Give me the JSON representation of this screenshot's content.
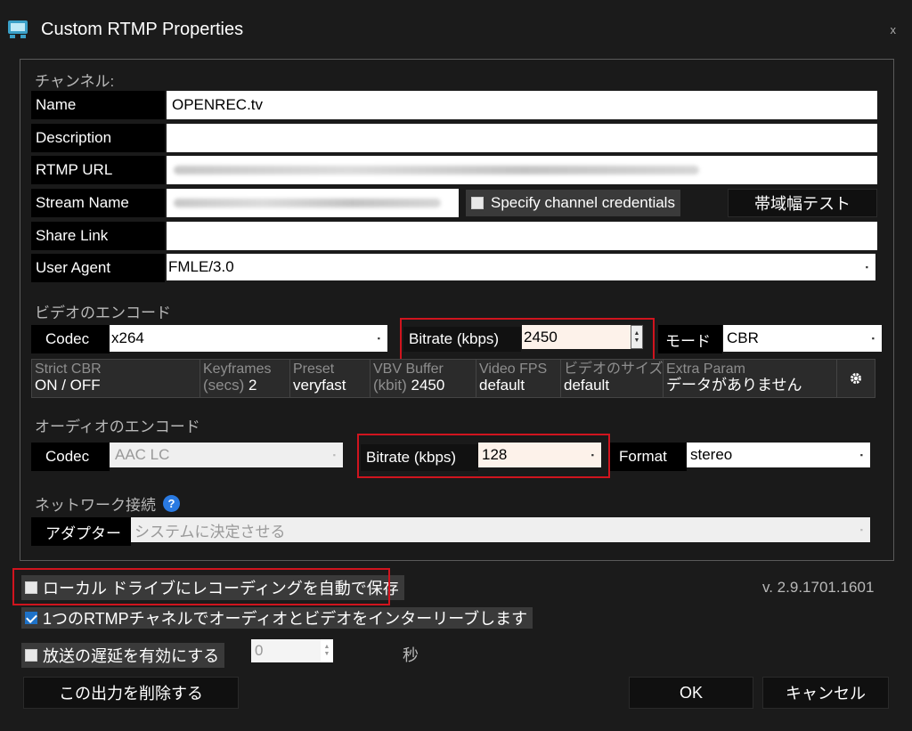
{
  "window": {
    "title": "Custom RTMP Properties",
    "close": "x",
    "version": "v. 2.9.1701.1601"
  },
  "channel": {
    "section": "チャンネル:",
    "name_label": "Name",
    "name_value": "OPENREC.tv",
    "description_label": "Description",
    "description_value": "",
    "rtmp_url_label": "RTMP URL",
    "stream_name_label": "Stream Name",
    "specify_credentials": "Specify channel credentials",
    "bandwidth_test": "帯域幅テスト",
    "share_link_label": "Share Link",
    "share_link_value": "",
    "user_agent_label": "User Agent",
    "user_agent_value": "FMLE/3.0"
  },
  "video": {
    "section": "ビデオのエンコード",
    "codec_label": "Codec",
    "codec_value": "x264",
    "bitrate_label": "Bitrate (kbps)",
    "bitrate_value": "2450",
    "mode_label": "モード",
    "mode_value": "CBR",
    "grid": {
      "strict_cbr_label": "Strict CBR",
      "strict_cbr_value": "ON / OFF",
      "keyframes_label": "Keyframes",
      "keyframes_unit": "(secs)",
      "keyframes_value": "2",
      "preset_label": "Preset",
      "preset_value": "veryfast",
      "vbv_label": "VBV Buffer",
      "vbv_unit": "(kbit)",
      "vbv_value": "2450",
      "fps_label": "Video FPS",
      "fps_value": "default",
      "size_label": "ビデオのサイズ",
      "size_value": "default",
      "extra_label": "Extra Param",
      "extra_value": "データがありません"
    }
  },
  "audio": {
    "section": "オーディオのエンコード",
    "codec_label": "Codec",
    "codec_value": "AAC LC",
    "bitrate_label": "Bitrate (kbps)",
    "bitrate_value": "128",
    "format_label": "Format",
    "format_value": "stereo"
  },
  "network": {
    "section": "ネットワーク接続",
    "help": "?",
    "adapter_label": "アダプター",
    "adapter_value": "システムに決定させる"
  },
  "options": {
    "save_local": "ローカル ドライブにレコーディングを自動で保存",
    "interleave": "1つのRTMPチャネルでオーディオとビデオをインターリーブします",
    "delay": "放送の遅延を有効にする",
    "delay_value": "0",
    "delay_unit": "秒"
  },
  "buttons": {
    "delete": "この出力を削除する",
    "ok": "OK",
    "cancel": "キャンセル"
  },
  "colors": {
    "highlight": "#d0141e",
    "accent": "#1e72c8",
    "background": "#1b1b1b"
  }
}
